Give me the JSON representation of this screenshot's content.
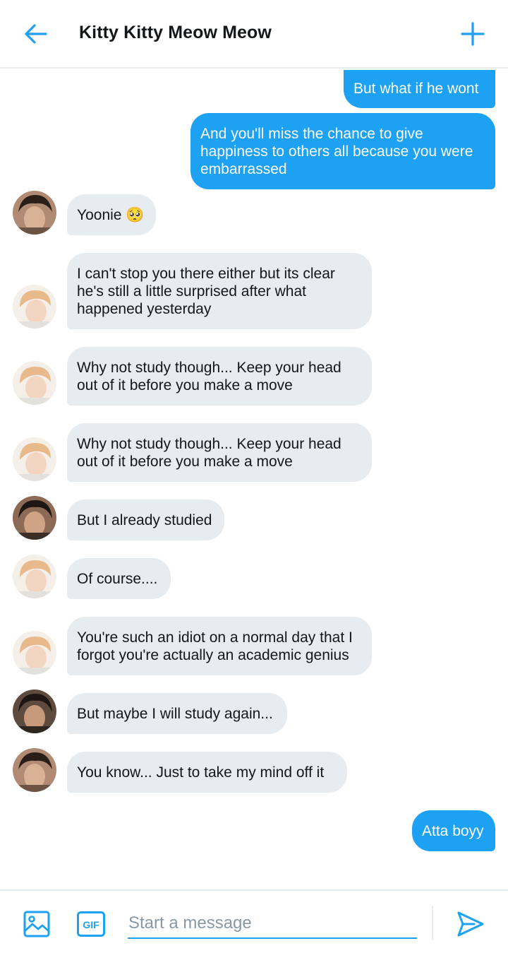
{
  "header": {
    "title": "Kitty Kitty Meow Meow",
    "back_icon": "arrow-left-icon",
    "action_icon": "plus-icon"
  },
  "colors": {
    "accent": "#1da1f2",
    "received_bubble": "#e6ecf0",
    "text": "#14171a",
    "placeholder": "#8899a6"
  },
  "messages": [
    {
      "side": "sent",
      "lines": [
        "But what if he wont"
      ]
    },
    {
      "side": "sent",
      "lines": [
        "And you'll miss the chance to give",
        "happiness to others all because you were",
        "embarrassed"
      ]
    },
    {
      "side": "received",
      "sender": "avatar-dark-hair",
      "lines": [
        "Yoonie 🥺"
      ]
    },
    {
      "side": "received",
      "sender": "avatar-blond-hair",
      "lines": [
        "I can't stop you there either but its clear",
        "he's still a little surprised after what",
        "happened yesterday"
      ]
    },
    {
      "side": "received",
      "sender": "avatar-blond-hair",
      "lines": [
        "Why not study though... Keep your head",
        "out of it before you make a move"
      ]
    },
    {
      "side": "received",
      "sender": "avatar-blond-hair",
      "lines": [
        "Why not study though... Keep your head",
        "out of it before you make a move"
      ]
    },
    {
      "side": "received",
      "sender": "avatar-dark-hair",
      "lines": [
        "But I already studied"
      ]
    },
    {
      "side": "received",
      "sender": "avatar-blond-hair",
      "lines": [
        "Of course...."
      ]
    },
    {
      "side": "received",
      "sender": "avatar-blond-hair",
      "lines": [
        "You're such an idiot on a normal day that I",
        "forgot you're actually an academic genius"
      ]
    },
    {
      "side": "received",
      "sender": "avatar-dark-hair",
      "lines": [
        "But maybe I will study again..."
      ]
    },
    {
      "side": "received",
      "sender": "avatar-dark-hair",
      "lines": [
        "You know... Just to take my mind off it"
      ]
    },
    {
      "side": "sent",
      "lines": [
        "Atta boyy"
      ]
    }
  ],
  "composer": {
    "placeholder": "Start a message",
    "value": "",
    "image_icon": "image-icon",
    "gif_label": "GIF",
    "send_icon": "send-icon"
  }
}
